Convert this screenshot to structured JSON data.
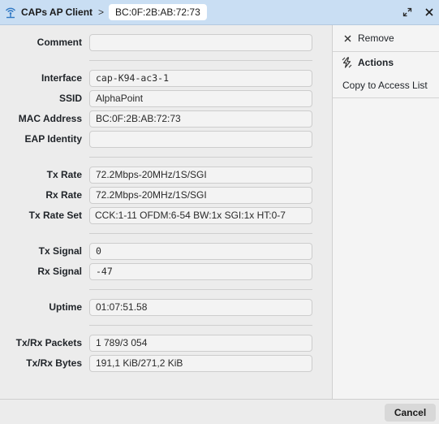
{
  "titlebar": {
    "title": "CAPs AP Client",
    "separator": ">",
    "crumb": "BC:0F:2B:AB:72:73",
    "icons": {
      "app": "wifi-antenna-icon",
      "restore": "restore-icon",
      "close": "close-icon"
    }
  },
  "form": {
    "comment": {
      "label": "Comment",
      "value": ""
    },
    "interface": {
      "label": "Interface",
      "value": "cap-K94-ac3-1"
    },
    "ssid": {
      "label": "SSID",
      "value": "AlphaPoint"
    },
    "mac_address": {
      "label": "MAC Address",
      "value": "BC:0F:2B:AB:72:73"
    },
    "eap_identity": {
      "label": "EAP Identity",
      "value": ""
    },
    "tx_rate": {
      "label": "Tx Rate",
      "value": "72.2Mbps-20MHz/1S/SGI"
    },
    "rx_rate": {
      "label": "Rx Rate",
      "value": "72.2Mbps-20MHz/1S/SGI"
    },
    "tx_rate_set": {
      "label": "Tx Rate Set",
      "value": "CCK:1-11 OFDM:6-54 BW:1x SGI:1x HT:0-7"
    },
    "tx_signal": {
      "label": "Tx Signal",
      "value": "0"
    },
    "rx_signal": {
      "label": "Rx Signal",
      "value": "-47"
    },
    "uptime": {
      "label": "Uptime",
      "value": "01:07:51.58"
    },
    "tx_rx_packets": {
      "label": "Tx/Rx Packets",
      "value": "1 789/3 054"
    },
    "tx_rx_bytes": {
      "label": "Tx/Rx Bytes",
      "value": "191,1 KiB/271,2 KiB"
    }
  },
  "sidebar": {
    "remove_label": "Remove",
    "actions_label": "Actions",
    "copy_label": "Copy to Access List"
  },
  "footer": {
    "cancel_label": "Cancel"
  }
}
